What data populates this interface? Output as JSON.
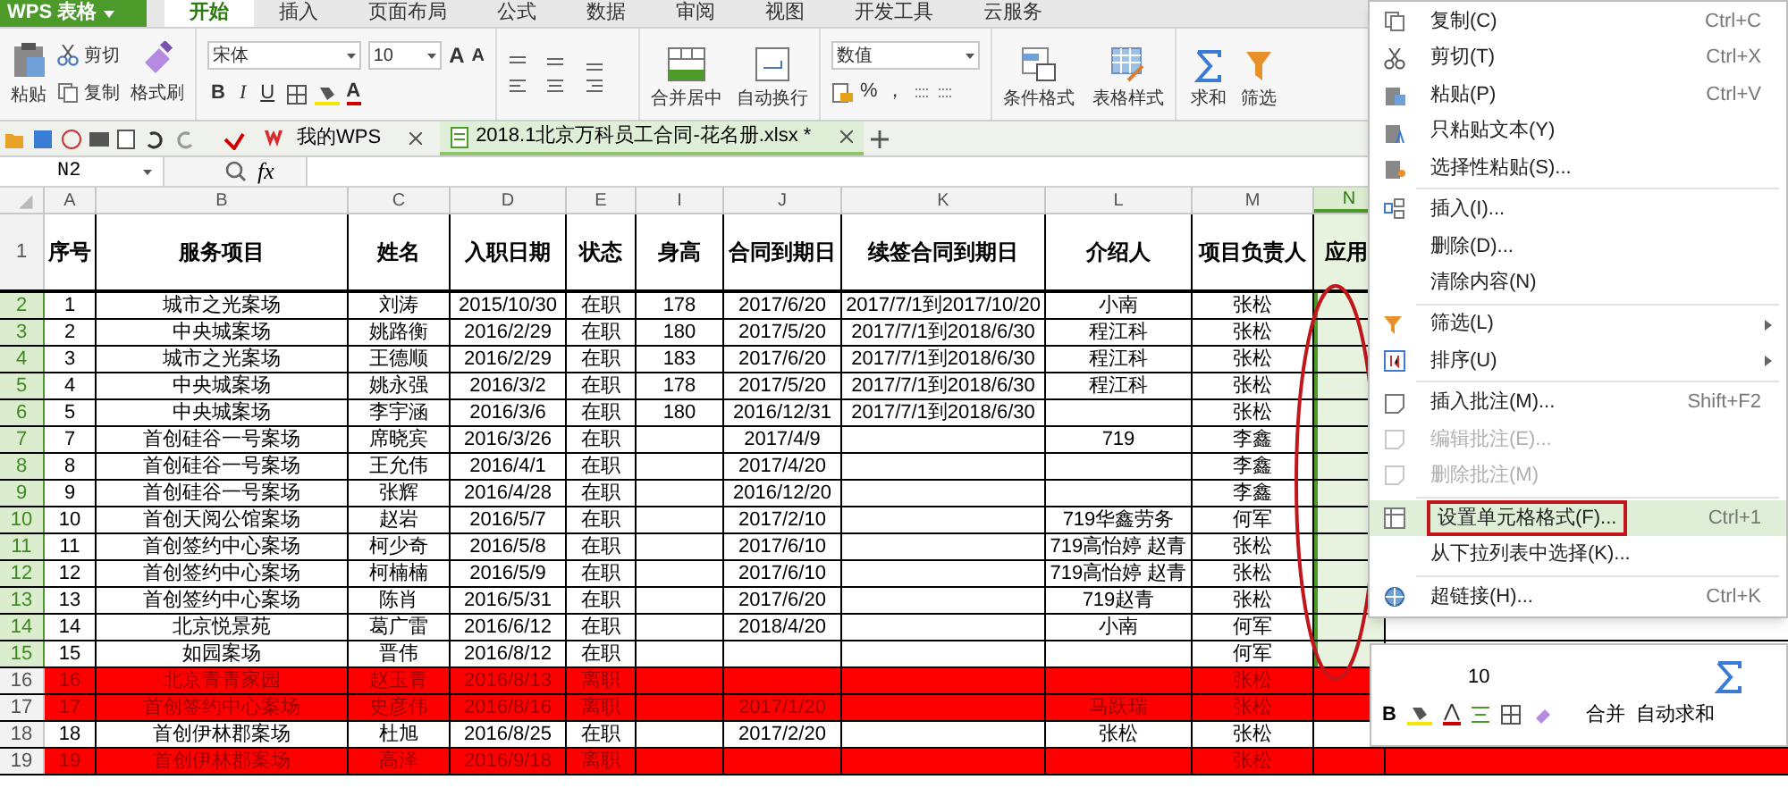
{
  "app": {
    "name": "WPS 表格"
  },
  "ribbon_tabs": [
    {
      "label": "开始",
      "selected": true
    },
    {
      "label": "插入",
      "selected": false
    },
    {
      "label": "页面布局",
      "selected": false
    },
    {
      "label": "公式",
      "selected": false
    },
    {
      "label": "数据",
      "selected": false
    },
    {
      "label": "审阅",
      "selected": false
    },
    {
      "label": "视图",
      "selected": false
    },
    {
      "label": "开发工具",
      "selected": false
    },
    {
      "label": "云服务",
      "selected": false
    }
  ],
  "ribbon": {
    "paste": "粘贴",
    "cut": "剪切",
    "copy": "复制",
    "format_painter": "格式刷",
    "font_name": "宋体",
    "font_size": "10",
    "grow": "A",
    "shrink": "A",
    "bold": "B",
    "italic": "I",
    "underline": "U",
    "font_color": "A",
    "merge": "合并居中",
    "wrap": "自动换行",
    "number_format": "数值",
    "percent": "%",
    "comma": "，",
    "conditional": "条件格式",
    "table_style": "表格样式",
    "sum": "求和",
    "filter": "筛选"
  },
  "doc_tabs": [
    {
      "label": "我的WPS",
      "selected": false
    },
    {
      "label": "2018.1北京万科员工合同-花名册.xlsx *",
      "selected": true
    }
  ],
  "formula_bar": {
    "cell": "N2",
    "fx": "fx"
  },
  "sheet": {
    "columns": [
      {
        "label": "A",
        "selected": false
      },
      {
        "label": "B",
        "selected": false
      },
      {
        "label": "C",
        "selected": false
      },
      {
        "label": "D",
        "selected": false
      },
      {
        "label": "E",
        "selected": false
      },
      {
        "label": "I",
        "selected": false
      },
      {
        "label": "J",
        "selected": false
      },
      {
        "label": "K",
        "selected": false
      },
      {
        "label": "L",
        "selected": false
      },
      {
        "label": "M",
        "selected": false
      },
      {
        "label": "N",
        "selected": true
      }
    ],
    "header": {
      "row": "1",
      "cells": [
        "序号",
        "服务项目",
        "姓名",
        "入职日期",
        "状态",
        "身高",
        "合同到期日",
        "续签合同到期日",
        "介绍人",
        "项目负责人",
        "应用"
      ]
    },
    "rows": [
      {
        "row": "2",
        "selected": true,
        "resigned": false,
        "cells": [
          "1",
          "城市之光案场",
          "刘涛",
          "2015/10/30",
          "在职",
          "178",
          "2017/6/20",
          "2017/7/1到2017/10/20",
          "小南",
          "张松"
        ]
      },
      {
        "row": "3",
        "selected": true,
        "resigned": false,
        "cells": [
          "2",
          "中央城案场",
          "姚路衡",
          "2016/2/29",
          "在职",
          "180",
          "2017/5/20",
          "2017/7/1到2018/6/30",
          "程江科",
          "张松"
        ]
      },
      {
        "row": "4",
        "selected": true,
        "resigned": false,
        "cells": [
          "3",
          "城市之光案场",
          "王德顺",
          "2016/2/29",
          "在职",
          "183",
          "2017/6/20",
          "2017/7/1到2018/6/30",
          "程江科",
          "张松"
        ]
      },
      {
        "row": "5",
        "selected": true,
        "resigned": false,
        "cells": [
          "4",
          "中央城案场",
          "姚永强",
          "2016/3/2",
          "在职",
          "178",
          "2017/5/20",
          "2017/7/1到2018/6/30",
          "程江科",
          "张松"
        ]
      },
      {
        "row": "6",
        "selected": true,
        "resigned": false,
        "cells": [
          "5",
          "中央城案场",
          "李宇涵",
          "2016/3/6",
          "在职",
          "180",
          "2016/12/31",
          "2017/7/1到2018/6/30",
          "",
          "张松"
        ]
      },
      {
        "row": "7",
        "selected": true,
        "resigned": false,
        "cells": [
          "7",
          "首创硅谷一号案场",
          "席晓宾",
          "2016/3/26",
          "在职",
          "",
          "2017/4/9",
          "",
          "719",
          "李鑫"
        ]
      },
      {
        "row": "8",
        "selected": true,
        "resigned": false,
        "cells": [
          "8",
          "首创硅谷一号案场",
          "王允伟",
          "2016/4/1",
          "在职",
          "",
          "2017/4/20",
          "",
          "",
          "李鑫"
        ]
      },
      {
        "row": "9",
        "selected": true,
        "resigned": false,
        "cells": [
          "9",
          "首创硅谷一号案场",
          "张辉",
          "2016/4/28",
          "在职",
          "",
          "2016/12/20",
          "",
          "",
          "李鑫"
        ]
      },
      {
        "row": "10",
        "selected": true,
        "resigned": false,
        "cells": [
          "10",
          "首创天阅公馆案场",
          "赵岩",
          "2016/5/7",
          "在职",
          "",
          "2017/2/10",
          "",
          "719华鑫劳务",
          "何军"
        ]
      },
      {
        "row": "11",
        "selected": true,
        "resigned": false,
        "cells": [
          "11",
          "首创签约中心案场",
          "柯少奇",
          "2016/5/8",
          "在职",
          "",
          "2017/6/10",
          "",
          "719高怡婷 赵青",
          "张松"
        ]
      },
      {
        "row": "12",
        "selected": true,
        "resigned": false,
        "cells": [
          "12",
          "首创签约中心案场",
          "柯楠楠",
          "2016/5/9",
          "在职",
          "",
          "2017/6/10",
          "",
          "719高怡婷 赵青",
          "张松"
        ]
      },
      {
        "row": "13",
        "selected": true,
        "resigned": false,
        "cells": [
          "13",
          "首创签约中心案场",
          "陈肖",
          "2016/5/31",
          "在职",
          "",
          "2017/6/20",
          "",
          "719赵青",
          "张松"
        ]
      },
      {
        "row": "14",
        "selected": true,
        "resigned": false,
        "cells": [
          "14",
          "北京悦景苑",
          "葛广雷",
          "2016/6/12",
          "在职",
          "",
          "2018/4/20",
          "",
          "小南",
          "何军"
        ]
      },
      {
        "row": "15",
        "selected": true,
        "resigned": false,
        "cells": [
          "15",
          "如园案场",
          "晋伟",
          "2016/8/12",
          "在职",
          "",
          "",
          "",
          "",
          "何军"
        ]
      },
      {
        "row": "16",
        "selected": false,
        "resigned": true,
        "cells": [
          "16",
          "北京青青家园",
          "赵玉青",
          "2016/8/13",
          "离职",
          "",
          "",
          "",
          "",
          "张松"
        ]
      },
      {
        "row": "17",
        "selected": false,
        "resigned": true,
        "cells": [
          "17",
          "首创签约中心案场",
          "史彦伟",
          "2016/8/16",
          "离职",
          "",
          "2017/1/20",
          "",
          "马跃瑞",
          "张松"
        ]
      },
      {
        "row": "18",
        "selected": false,
        "resigned": false,
        "cells": [
          "18",
          "首创伊林郡案场",
          "杜旭",
          "2016/8/25",
          "在职",
          "",
          "2017/2/20",
          "",
          "张松",
          "张松"
        ]
      },
      {
        "row": "19",
        "selected": false,
        "resigned": true,
        "cells": [
          "19",
          "首创伊林郡案场",
          "高泽",
          "2016/9/18",
          "离职",
          "",
          "",
          "",
          "",
          "张松"
        ]
      }
    ]
  },
  "context_menu": {
    "groups": [
      [
        {
          "label": "复制(C)",
          "shortcut": "Ctrl+C",
          "disabled": false,
          "submenu": false,
          "selected": false
        },
        {
          "label": "剪切(T)",
          "shortcut": "Ctrl+X",
          "disabled": false,
          "submenu": false,
          "selected": false
        },
        {
          "label": "粘贴(P)",
          "shortcut": "Ctrl+V",
          "disabled": false,
          "submenu": false,
          "selected": false
        },
        {
          "label": "只粘贴文本(Y)",
          "disabled": false,
          "submenu": false,
          "selected": false
        },
        {
          "label": "选择性粘贴(S)...",
          "disabled": false,
          "submenu": false,
          "selected": false
        }
      ],
      [
        {
          "label": "插入(I)...",
          "disabled": false,
          "submenu": false,
          "selected": false
        },
        {
          "label": "删除(D)...",
          "disabled": false,
          "submenu": false,
          "selected": false
        },
        {
          "label": "清除内容(N)",
          "disabled": false,
          "submenu": false,
          "selected": false
        }
      ],
      [
        {
          "label": "筛选(L)",
          "disabled": false,
          "submenu": true,
          "selected": false
        },
        {
          "label": "排序(U)",
          "disabled": false,
          "submenu": true,
          "selected": false
        }
      ],
      [
        {
          "label": "插入批注(M)...",
          "shortcut": "Shift+F2",
          "disabled": false,
          "submenu": false,
          "selected": false
        },
        {
          "label": "编辑批注(E)...",
          "disabled": true,
          "submenu": false,
          "selected": false
        },
        {
          "label": "删除批注(M)",
          "disabled": true,
          "submenu": false,
          "selected": false
        }
      ],
      [
        {
          "label": "设置单元格格式(F)...",
          "shortcut": "Ctrl+1",
          "disabled": false,
          "submenu": false,
          "selected": true
        },
        {
          "label": "从下拉列表中选择(K)...",
          "disabled": false,
          "submenu": false,
          "selected": false
        }
      ],
      [
        {
          "label": "超链接(H)...",
          "shortcut": "Ctrl+K",
          "disabled": false,
          "submenu": false,
          "selected": false
        }
      ]
    ]
  },
  "mini_toolbar": {
    "size": "10",
    "bold": "B",
    "merge": "合并",
    "autosum": "自动求和"
  }
}
